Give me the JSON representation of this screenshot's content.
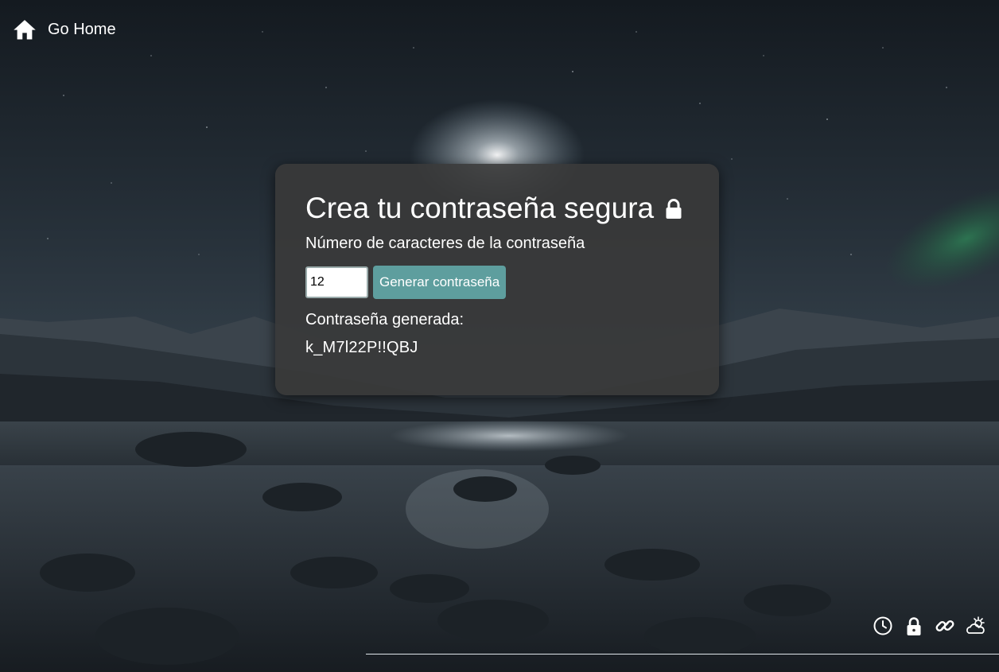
{
  "nav": {
    "home_label": "Go Home",
    "home_icon": "home-icon"
  },
  "card": {
    "title": "Crea tu contraseña segura",
    "title_icon": "lock-icon",
    "length_label": "Número de caracteres de la contraseña",
    "length_value": "12",
    "generate_label": "Generar contraseña",
    "result_label": "Contraseña generada:",
    "result_value": "k_M7l22P!!QBJ"
  },
  "dock": {
    "icons": [
      "clock-icon",
      "lock-icon",
      "link-icon",
      "weather-icon"
    ]
  },
  "colors": {
    "button": "#5e9e9e",
    "card_bg": "#3a3a3a",
    "text": "#ffffff"
  }
}
